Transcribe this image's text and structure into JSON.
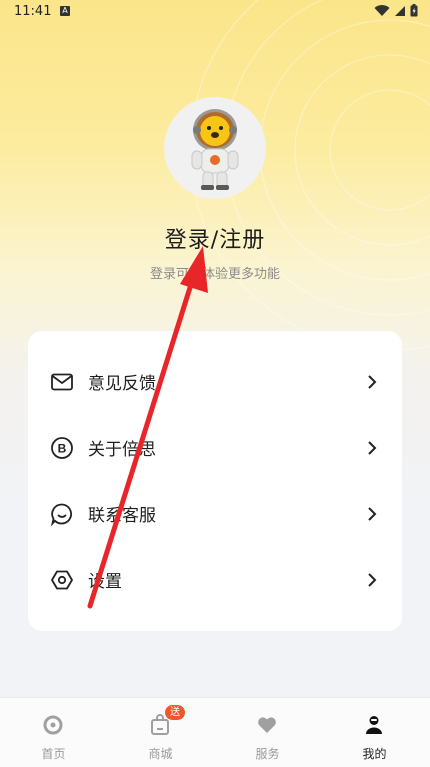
{
  "status_bar": {
    "time": "11:41",
    "notification_icon": "a-icon",
    "icons": [
      "wifi-icon",
      "signal-icon",
      "battery-icon"
    ]
  },
  "profile": {
    "avatar_icon": "lion-astronaut-avatar",
    "title": "登录/注册",
    "subtitle": "登录可以体验更多功能"
  },
  "menu": {
    "items": [
      {
        "label": "意见反馈",
        "icon": "mail-icon"
      },
      {
        "label": "关于倍思",
        "icon": "brand-b-icon"
      },
      {
        "label": "联系客服",
        "icon": "chat-icon"
      },
      {
        "label": "设置",
        "icon": "settings-icon"
      }
    ]
  },
  "tabbar": {
    "tabs": [
      {
        "label": "首页",
        "icon": "home-icon"
      },
      {
        "label": "商城",
        "icon": "shop-bag-icon",
        "badge": "送"
      },
      {
        "label": "服务",
        "icon": "heart-icon"
      },
      {
        "label": "我的",
        "icon": "profile-icon",
        "active": true
      }
    ]
  },
  "colors": {
    "header_yellow": "#fbe58a",
    "background": "#f2f3f7",
    "badge": "#f0562b",
    "annotation_arrow": "#e8262a"
  }
}
